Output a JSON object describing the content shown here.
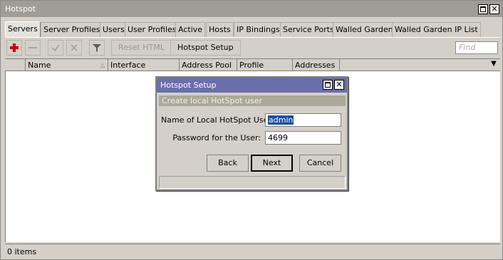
{
  "window": {
    "title": "Hotspot"
  },
  "tabs": [
    {
      "label": "Servers"
    },
    {
      "label": "Server Profiles"
    },
    {
      "label": "Users"
    },
    {
      "label": "User Profiles"
    },
    {
      "label": "Active"
    },
    {
      "label": "Hosts"
    },
    {
      "label": "IP Bindings"
    },
    {
      "label": "Service Ports"
    },
    {
      "label": "Walled Garden"
    },
    {
      "label": "Walled Garden IP List"
    }
  ],
  "toolbar": {
    "add_icon": "plus-icon",
    "remove_icon": "minus-icon",
    "enable_icon": "check-icon",
    "disable_icon": "x-icon",
    "filter_icon": "funnel-icon",
    "reset_html_label": "Reset HTML",
    "hotspot_setup_label": "Hotspot Setup",
    "find_placeholder": "Find"
  },
  "table": {
    "columns": [
      "Name",
      "Interface",
      "Address Pool",
      "Profile",
      "Addresses"
    ]
  },
  "status": {
    "items": "0 items"
  },
  "dialog": {
    "title": "Hotspot Setup",
    "subtitle": "Create local HotSpot user",
    "user_label": "Name of Local HotSpot User:",
    "user_value": "admin",
    "password_label": "Password for the User:",
    "password_value": "4699",
    "back_label": "Back",
    "next_label": "Next",
    "cancel_label": "Cancel"
  },
  "colors": {
    "dialog_titlebar": "#6a6eaa",
    "window_titlebar": "#a09c96",
    "selection": "#1c4e9e",
    "add_icon": "#cc0000"
  }
}
